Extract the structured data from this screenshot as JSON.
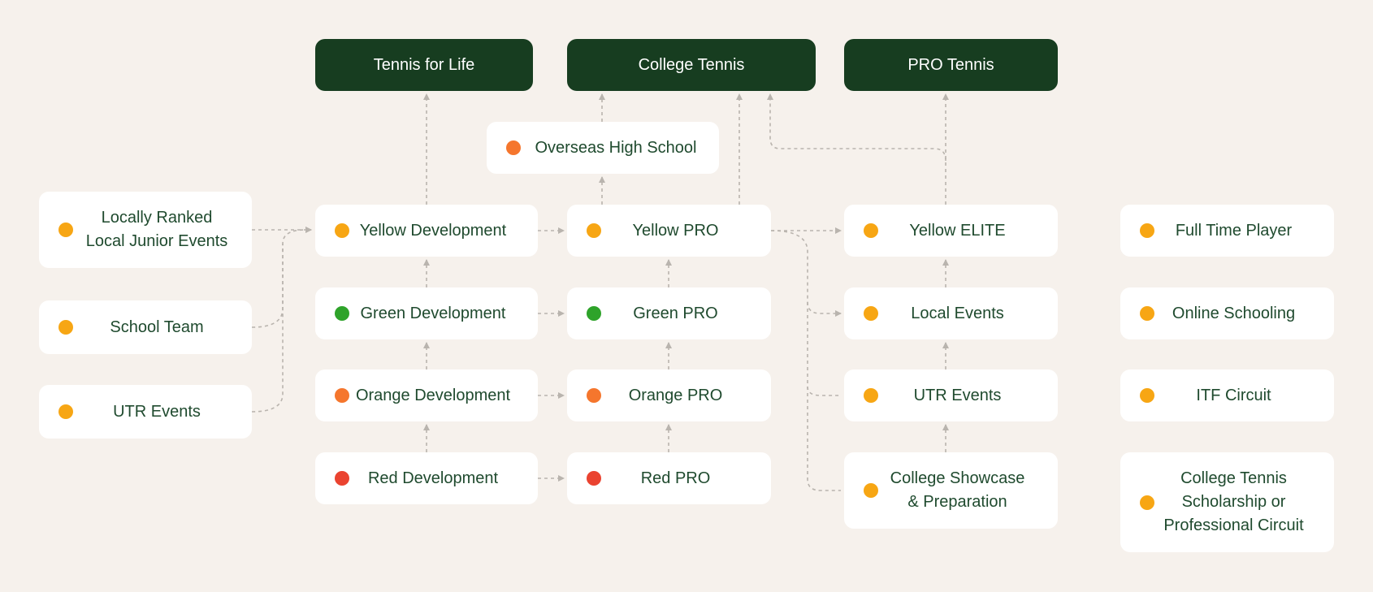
{
  "colors": {
    "background": "#f6f1ec",
    "goal_box": "#173d20",
    "text": "#1f4a2e",
    "yellow": "#f7a614",
    "green": "#2ea32a",
    "orange": "#f5762d",
    "red": "#ea4330",
    "connector": "#b9b4ae"
  },
  "goals": {
    "tennis_for_life": "Tennis for Life",
    "college_tennis": "College Tennis",
    "pro_tennis": "PRO Tennis"
  },
  "overseas_high_school": {
    "label": "Overseas High School",
    "dot": "orange"
  },
  "inputs": [
    {
      "label": "Locally Ranked\nLocal Junior Events",
      "dot": "yellow"
    },
    {
      "label": "School Team",
      "dot": "yellow"
    },
    {
      "label": "UTR Events",
      "dot": "yellow"
    }
  ],
  "development": [
    {
      "label": "Yellow Development",
      "dot": "yellow"
    },
    {
      "label": "Green Development",
      "dot": "green"
    },
    {
      "label": "Orange Development",
      "dot": "orange"
    },
    {
      "label": "Red Development",
      "dot": "red"
    }
  ],
  "pro": [
    {
      "label": "Yellow PRO",
      "dot": "yellow"
    },
    {
      "label": "Green PRO",
      "dot": "green"
    },
    {
      "label": "Orange PRO",
      "dot": "orange"
    },
    {
      "label": "Red PRO",
      "dot": "red"
    }
  ],
  "elite": [
    {
      "label": "Yellow ELITE",
      "dot": "yellow"
    },
    {
      "label": "Local Events",
      "dot": "yellow"
    },
    {
      "label": "UTR Events",
      "dot": "yellow"
    },
    {
      "label": "College Showcase\n& Preparation",
      "dot": "yellow"
    }
  ],
  "outcomes": [
    {
      "label": "Full Time Player",
      "dot": "yellow"
    },
    {
      "label": "Online Schooling",
      "dot": "yellow"
    },
    {
      "label": "ITF Circuit",
      "dot": "yellow"
    },
    {
      "label": "College Tennis\nScholarship or\nProfessional Circuit",
      "dot": "yellow"
    }
  ]
}
